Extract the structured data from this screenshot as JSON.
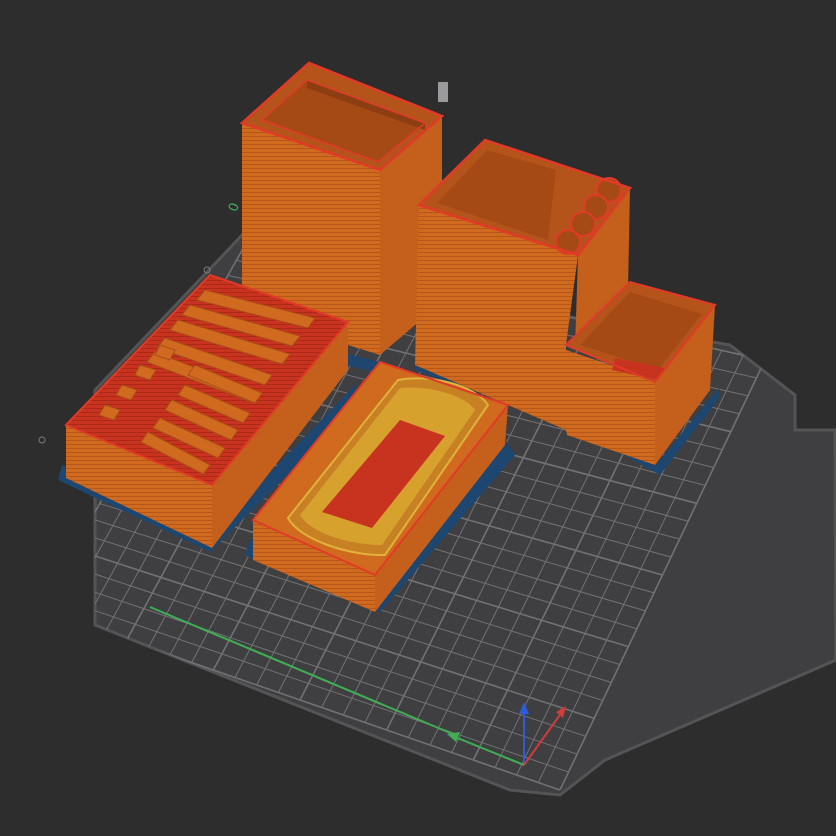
{
  "viewport": {
    "background_color": "#2d2d2e",
    "bed_color": "#3f3f41",
    "bed_edge_color": "#545457",
    "grid_color": "#7b7b7e",
    "model_color": "#d06a1f",
    "model_dark_color": "#b4541a",
    "model_red_color": "#c8331f",
    "model_yellow_color": "#d8a12a",
    "skirt_color": "#1d4670",
    "axis_x_color": "#d13b3b",
    "axis_y_color": "#3fae55",
    "axis_z_color": "#2f5bd8"
  },
  "objects": [
    {
      "name": "tall-box-container"
    },
    {
      "name": "l-shaped-organizer"
    },
    {
      "name": "slotted-tray"
    },
    {
      "name": "oval-dish"
    }
  ],
  "icons": {
    "axis_gizmo": "xyz-axis-gizmo-icon",
    "origin_marker": "bed-origin-marker-icon"
  }
}
